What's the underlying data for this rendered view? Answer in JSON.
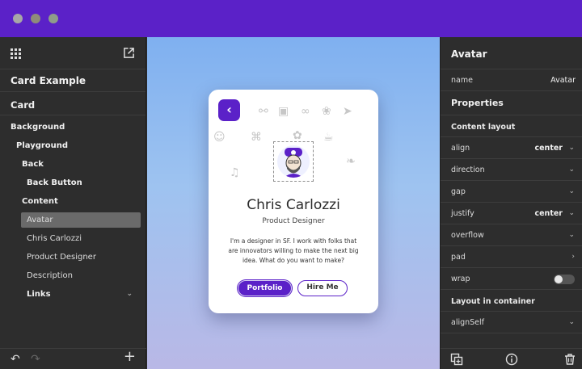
{
  "window": {
    "title_bar_color": "#5b21c8"
  },
  "left_panel": {
    "document_title": "Card Example",
    "tree": [
      {
        "label": "Card",
        "level": 0,
        "bold": true,
        "root": true
      },
      {
        "label": "Background",
        "level": 0,
        "bold": true
      },
      {
        "label": "Playground",
        "level": 1,
        "bold": true
      },
      {
        "label": "Back",
        "level": 2,
        "bold": true
      },
      {
        "label": "Back Button",
        "level": 3,
        "bold": true
      },
      {
        "label": "Content",
        "level": 2,
        "bold": true
      },
      {
        "label": "Avatar",
        "level": 3,
        "bold": false,
        "selected": true
      },
      {
        "label": "Chris Carlozzi",
        "level": 3,
        "bold": false
      },
      {
        "label": "Product Designer",
        "level": 3,
        "bold": false
      },
      {
        "label": "Description",
        "level": 3,
        "bold": false
      },
      {
        "label": "Links",
        "level": 3,
        "bold": true,
        "expandable": true
      }
    ]
  },
  "card": {
    "name": "Chris Carlozzi",
    "role": "Product Designer",
    "description": "I'm a designer in SF. I work with folks that are innovators willing to make the next big idea. What do you want to make?",
    "primary_button": "Portfolio",
    "secondary_button": "Hire Me",
    "accent_color": "#5b21c8"
  },
  "right_panel": {
    "title": "Avatar",
    "name_label": "name",
    "name_value": "Avatar",
    "properties_heading": "Properties",
    "content_layout_heading": "Content layout",
    "align_label": "align",
    "align_value": "center",
    "direction_label": "direction",
    "gap_label": "gap",
    "justify_label": "justify",
    "justify_value": "center",
    "overflow_label": "overflow",
    "pad_label": "pad",
    "wrap_label": "wrap",
    "wrap_on": false,
    "layout_in_container_heading": "Layout in container",
    "alignself_label": "alignSelf"
  }
}
